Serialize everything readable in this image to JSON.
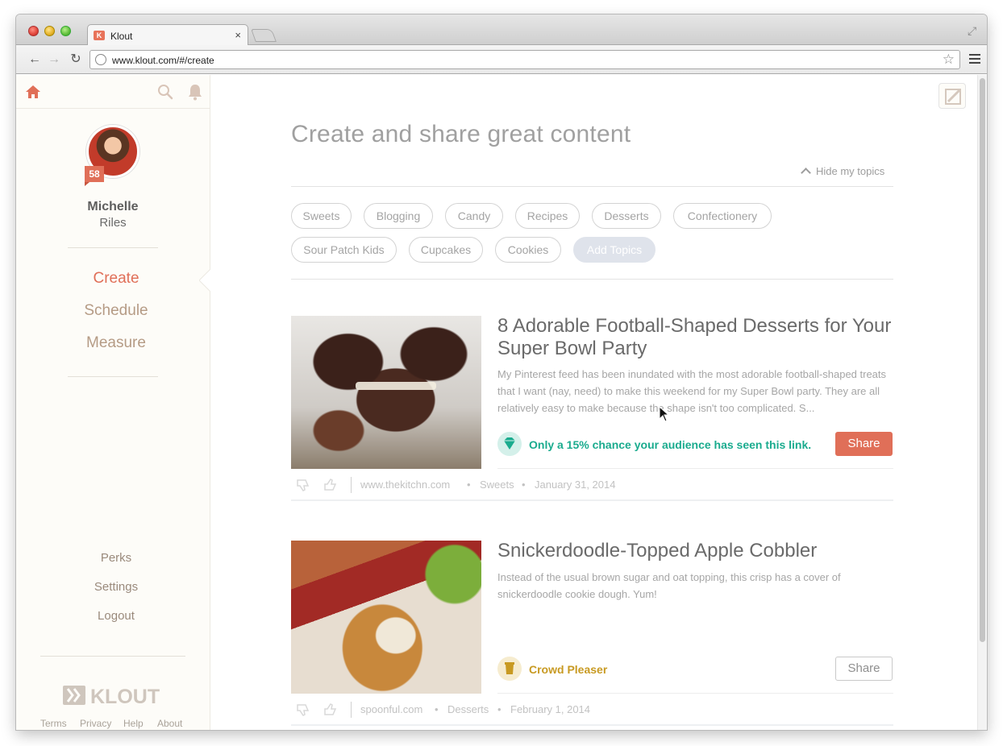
{
  "browser": {
    "tab_title": "Klout",
    "tab_favicon": "K",
    "url": "www.klout.com/#/create"
  },
  "sidebar": {
    "user": {
      "first_name": "Michelle",
      "last_name": "Riles",
      "score": "58"
    },
    "nav": [
      {
        "label": "Create",
        "active": true
      },
      {
        "label": "Schedule",
        "active": false
      },
      {
        "label": "Measure",
        "active": false
      }
    ],
    "footer_links": [
      "Perks",
      "Settings",
      "Logout"
    ],
    "logo_text": "KLOUT",
    "legal": [
      "Terms",
      "Privacy",
      "Help",
      "About"
    ]
  },
  "main": {
    "title": "Create and share great content",
    "hide_topics": "Hide my topics",
    "topics_row1": [
      "Sweets",
      "Blogging",
      "Candy",
      "Recipes",
      "Desserts",
      "Confectionery"
    ],
    "topics_row2": [
      "Sour Patch Kids",
      "Cupcakes",
      "Cookies"
    ],
    "add_topics": "Add Topics",
    "cards": [
      {
        "title": "8 Adorable Football-Shaped Desserts for Your Super Bowl Party",
        "description": "My Pinterest feed has been inundated with the most adorable football-shaped treats that I want (nay, need) to make this weekend for my Super Bowl party. They are all relatively easy to make because the shape isn't too complicated. S...",
        "insight": "Only a 15% chance your audience has seen this link.",
        "insight_icon": "diamond-icon",
        "insight_color": "#1aab8e",
        "share_label": "Share",
        "source": "www.thekitchn.com",
        "topic": "Sweets",
        "date": "January 31, 2014"
      },
      {
        "title": "Snickerdoodle-Topped Apple Cobbler",
        "description": "Instead of the usual brown sugar and oat topping, this crisp has a cover of snickerdoodle cookie dough. Yum!",
        "insight": "Crowd Pleaser",
        "insight_icon": "cup-icon",
        "insight_color": "#c89a22",
        "share_label": "Share",
        "source": "spoonful.com",
        "topic": "Desserts",
        "date": "February 1, 2014"
      }
    ]
  },
  "colors": {
    "accent": "#e06f58",
    "muted_nav": "#b59b85",
    "teal": "#1aab8e",
    "gold": "#c89a22"
  }
}
